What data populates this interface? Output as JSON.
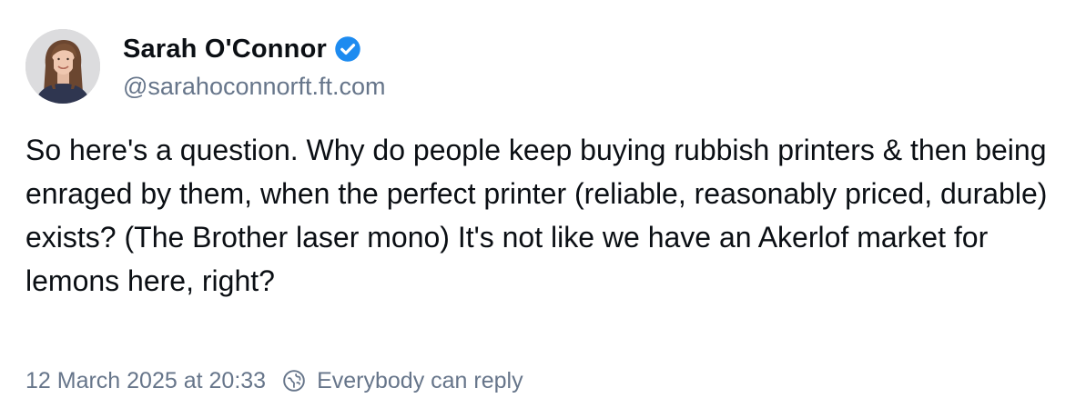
{
  "post": {
    "author": {
      "name": "Sarah O'Connor",
      "handle": "@sarahoconnorft.ft.com",
      "verified": true,
      "verified_color": "#1d8bf0",
      "avatar_icon": "profile-photo"
    },
    "text": "So here's a question. Why do people keep buying rubbish printers & then being enraged by them, when the perfect printer (reliable, reasonably priced, durable) exists? (The Brother laser mono) It's not like we have an Akerlof market for lemons here, right?",
    "timestamp": "12 March 2025 at 20:33",
    "reply_setting_icon": "globe-reply-icon",
    "reply_setting": "Everybody can reply"
  },
  "colors": {
    "text_primary": "#0b0f14",
    "text_secondary": "#66758a"
  }
}
